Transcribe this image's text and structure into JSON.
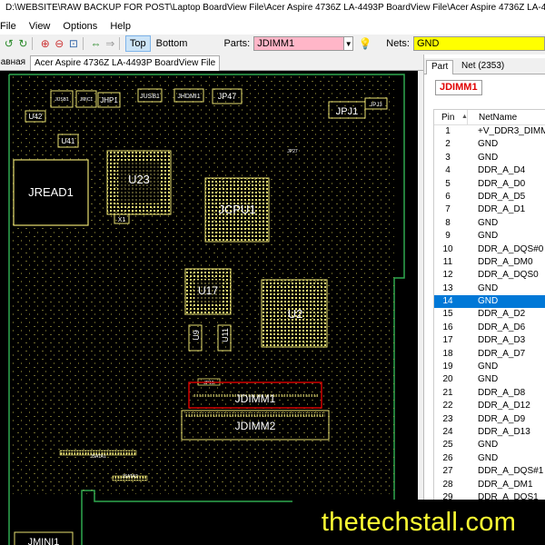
{
  "window": {
    "title": "D:\\WEBSITE\\RAW BACKUP FOR POST\\Laptop BoardView File\\Acer Aspire 4736Z LA-4493P BoardView File\\Acer Aspire 4736Z LA-4493P BoardView File.s"
  },
  "menu": {
    "file": "File",
    "view": "View",
    "options": "Options",
    "help": "Help"
  },
  "toolbar": {
    "top_label": "Top",
    "bottom_label": "Bottom",
    "parts_label": "Parts:",
    "parts_value": "JDIMM1",
    "nets_label": "Nets:",
    "nets_value": "GND"
  },
  "doc_tabs": {
    "inactive": "Главная",
    "active": "Acer Aspire 4736Z LA-4493P BoardView File"
  },
  "board": {
    "labels": {
      "jread1": "JREAD1",
      "u23": "U23",
      "jcpu1": "JCPU1",
      "u17": "U17",
      "u2": "U2",
      "jdimm1": "JDIMM1",
      "jdimm2": "JDIMM2",
      "jpj1": "JPJ1",
      "jhp1": "JHP1",
      "u42": "U42",
      "u41": "U41",
      "jusb1": "JUSB1",
      "jhdmi1": "JHDMI1",
      "jp47": "JP47",
      "jpj3": "JPJ3",
      "jp27": "JP27",
      "u9": "U9",
      "u11": "U11",
      "x1": "X1",
      "jp19": "JP19",
      "jsata1": "JSATA1",
      "jsata2": "JSATA2",
      "jmini1": "JMINI1",
      "jusb_sm": "JUSB1",
      "jmic1": "JMIC1"
    }
  },
  "right_panel": {
    "tabs": {
      "part": "Part",
      "net": "Net (2353)"
    },
    "part_name": "JDIMM1",
    "columns": {
      "pin": "Pin",
      "netname": "NetName"
    },
    "selected_pin": "14",
    "pins": [
      {
        "pin": "1",
        "net": "+V_DDR3_DIMM_REF"
      },
      {
        "pin": "2",
        "net": "GND"
      },
      {
        "pin": "3",
        "net": "GND"
      },
      {
        "pin": "4",
        "net": "DDR_A_D4"
      },
      {
        "pin": "5",
        "net": "DDR_A_D0"
      },
      {
        "pin": "6",
        "net": "DDR_A_D5"
      },
      {
        "pin": "7",
        "net": "DDR_A_D1"
      },
      {
        "pin": "8",
        "net": "GND"
      },
      {
        "pin": "9",
        "net": "GND"
      },
      {
        "pin": "10",
        "net": "DDR_A_DQS#0"
      },
      {
        "pin": "11",
        "net": "DDR_A_DM0"
      },
      {
        "pin": "12",
        "net": "DDR_A_DQS0"
      },
      {
        "pin": "13",
        "net": "GND"
      },
      {
        "pin": "14",
        "net": "GND"
      },
      {
        "pin": "15",
        "net": "DDR_A_D2"
      },
      {
        "pin": "16",
        "net": "DDR_A_D6"
      },
      {
        "pin": "17",
        "net": "DDR_A_D3"
      },
      {
        "pin": "18",
        "net": "DDR_A_D7"
      },
      {
        "pin": "19",
        "net": "GND"
      },
      {
        "pin": "20",
        "net": "GND"
      },
      {
        "pin": "21",
        "net": "DDR_A_D8"
      },
      {
        "pin": "22",
        "net": "DDR_A_D12"
      },
      {
        "pin": "23",
        "net": "DDR_A_D9"
      },
      {
        "pin": "24",
        "net": "DDR_A_D13"
      },
      {
        "pin": "25",
        "net": "GND"
      },
      {
        "pin": "26",
        "net": "GND"
      },
      {
        "pin": "27",
        "net": "DDR_A_DQS#1"
      },
      {
        "pin": "28",
        "net": "DDR_A_DM1"
      },
      {
        "pin": "29",
        "net": "DDR_A_DQS1"
      }
    ]
  },
  "watermark": "thetechstall.com",
  "colors": {
    "board_bg": "#000000",
    "outline": "#2fa84f",
    "part": "#e8e070",
    "selected_part": "#e00000",
    "parts_input_bg": "#ffb6c8",
    "nets_input_bg": "#ffff00",
    "selection": "#0078d7"
  }
}
